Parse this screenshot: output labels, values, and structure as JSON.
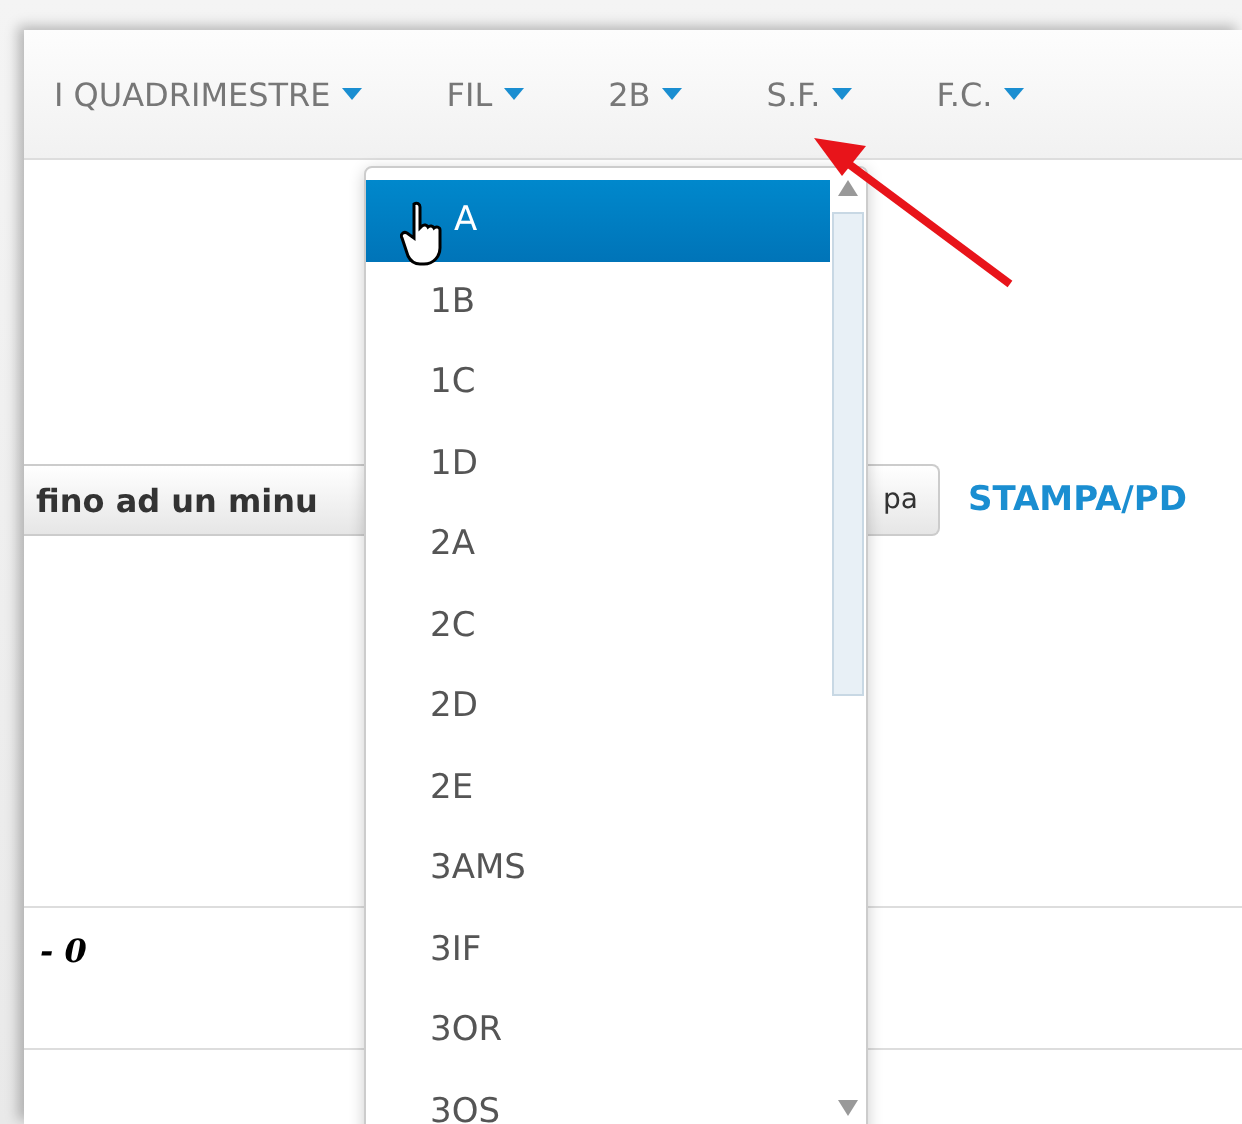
{
  "navbar": {
    "menus": [
      {
        "label": "I QUADRIMESTRE"
      },
      {
        "label": "FIL"
      },
      {
        "label": "2B"
      },
      {
        "label": "S.F."
      },
      {
        "label": "F.C."
      }
    ]
  },
  "toolbar": {
    "button_left": "fino ad un minu",
    "button_right": "pa",
    "link": "STAMPA/PD"
  },
  "table": {
    "cell": "- 0"
  },
  "dropdown": {
    "items": [
      {
        "label": "A",
        "selected": true
      },
      {
        "label": "1B",
        "selected": false
      },
      {
        "label": "1C",
        "selected": false
      },
      {
        "label": "1D",
        "selected": false
      },
      {
        "label": "2A",
        "selected": false
      },
      {
        "label": "2C",
        "selected": false
      },
      {
        "label": "2D",
        "selected": false
      },
      {
        "label": "2E",
        "selected": false
      },
      {
        "label": "3AMS",
        "selected": false
      },
      {
        "label": "3IF",
        "selected": false
      },
      {
        "label": "3OR",
        "selected": false
      },
      {
        "label": "3OS",
        "selected": false
      }
    ]
  }
}
